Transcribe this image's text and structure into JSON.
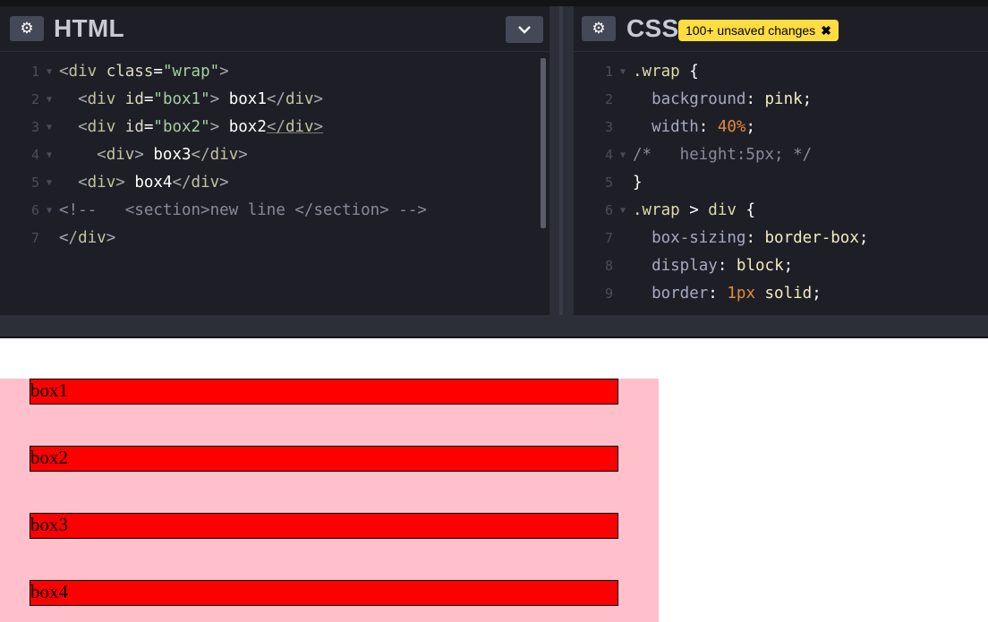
{
  "html_panel": {
    "title": "HTML",
    "lines": [
      {
        "n": "1",
        "fold": "▼",
        "tokens": [
          [
            "t-tag",
            "<"
          ],
          [
            "t-tagn",
            "div"
          ],
          [
            "t-txt",
            " "
          ],
          [
            "t-attr",
            "class"
          ],
          [
            "t-eq",
            "="
          ],
          [
            "t-str",
            "\"wrap\""
          ],
          [
            "t-tag",
            ">"
          ]
        ]
      },
      {
        "n": "2",
        "fold": "▼",
        "tokens": [
          [
            "t-txt",
            "  "
          ],
          [
            "t-tag",
            "<"
          ],
          [
            "t-tagn",
            "div"
          ],
          [
            "t-txt",
            " "
          ],
          [
            "t-attr",
            "id"
          ],
          [
            "t-eq",
            "="
          ],
          [
            "t-str",
            "\"box1\""
          ],
          [
            "t-tag",
            ">"
          ],
          [
            "t-text",
            " box1"
          ],
          [
            "t-tag",
            "</"
          ],
          [
            "t-tagn",
            "div"
          ],
          [
            "t-tag",
            ">"
          ]
        ]
      },
      {
        "n": "3",
        "fold": "▼",
        "tokens": [
          [
            "t-txt",
            "  "
          ],
          [
            "t-tag",
            "<"
          ],
          [
            "t-tagn",
            "div"
          ],
          [
            "t-txt",
            " "
          ],
          [
            "t-attr",
            "id"
          ],
          [
            "t-eq",
            "="
          ],
          [
            "t-str",
            "\"box2\""
          ],
          [
            "t-tag",
            ">"
          ],
          [
            "t-text",
            " box2"
          ],
          [
            "t-tag under",
            "</"
          ],
          [
            "t-tagn under",
            "div"
          ],
          [
            "t-tag under",
            ">"
          ]
        ]
      },
      {
        "n": "4",
        "fold": "▼",
        "tokens": [
          [
            "t-txt",
            "    "
          ],
          [
            "t-tag",
            "<"
          ],
          [
            "t-tagn",
            "div"
          ],
          [
            "t-tag",
            ">"
          ],
          [
            "t-text",
            " box3"
          ],
          [
            "t-tag",
            "</"
          ],
          [
            "t-tagn",
            "div"
          ],
          [
            "t-tag",
            ">"
          ]
        ]
      },
      {
        "n": "5",
        "fold": "▼",
        "tokens": [
          [
            "t-txt",
            "  "
          ],
          [
            "t-tag",
            "<"
          ],
          [
            "t-tagn",
            "div"
          ],
          [
            "t-tag",
            ">"
          ],
          [
            "t-text",
            " box4"
          ],
          [
            "t-tag",
            "</"
          ],
          [
            "t-tagn",
            "div"
          ],
          [
            "t-tag",
            ">"
          ]
        ]
      },
      {
        "n": "6",
        "fold": "▼",
        "tokens": [
          [
            "t-com",
            "<!--   <section>new line </section> -->"
          ]
        ]
      },
      {
        "n": "7",
        "fold": "",
        "tokens": [
          [
            "t-tag",
            "</"
          ],
          [
            "t-tagn",
            "div"
          ],
          [
            "t-tag",
            ">"
          ]
        ]
      }
    ]
  },
  "css_panel": {
    "title": "CSS",
    "badge": {
      "label": "100+ unsaved changes",
      "close": "✖"
    },
    "lines": [
      {
        "n": "1",
        "fold": "▼",
        "tokens": [
          [
            "t-sel",
            ".wrap"
          ],
          [
            "t-punc",
            " {"
          ]
        ]
      },
      {
        "n": "2",
        "fold": "",
        "tokens": [
          [
            "t-txt",
            "  "
          ],
          [
            "t-prop",
            "background"
          ],
          [
            "t-punc",
            ": "
          ],
          [
            "t-val",
            "pink"
          ],
          [
            "t-punc",
            ";"
          ]
        ]
      },
      {
        "n": "3",
        "fold": "",
        "tokens": [
          [
            "t-txt",
            "  "
          ],
          [
            "t-prop",
            "width"
          ],
          [
            "t-punc",
            ": "
          ],
          [
            "t-num",
            "40%"
          ],
          [
            "t-punc",
            ";"
          ]
        ]
      },
      {
        "n": "4",
        "fold": "▼",
        "tokens": [
          [
            "t-com",
            "/*   height:5px; */"
          ]
        ]
      },
      {
        "n": "5",
        "fold": "",
        "tokens": [
          [
            "t-punc",
            "}"
          ]
        ]
      },
      {
        "n": "6",
        "fold": "▼",
        "tokens": [
          [
            "t-sel",
            ".wrap"
          ],
          [
            "t-punc",
            " > "
          ],
          [
            "t-sel",
            "div"
          ],
          [
            "t-punc",
            " {"
          ]
        ]
      },
      {
        "n": "7",
        "fold": "",
        "tokens": [
          [
            "t-txt",
            "  "
          ],
          [
            "t-prop",
            "box-sizing"
          ],
          [
            "t-punc",
            ": "
          ],
          [
            "t-val",
            "border-box"
          ],
          [
            "t-punc",
            ";"
          ]
        ]
      },
      {
        "n": "8",
        "fold": "",
        "tokens": [
          [
            "t-txt",
            "  "
          ],
          [
            "t-prop",
            "display"
          ],
          [
            "t-punc",
            ": "
          ],
          [
            "t-val",
            "block"
          ],
          [
            "t-punc",
            ";"
          ]
        ]
      },
      {
        "n": "9",
        "fold": "",
        "tokens": [
          [
            "t-txt",
            "  "
          ],
          [
            "t-prop",
            "border"
          ],
          [
            "t-punc",
            ": "
          ],
          [
            "t-num",
            "1px"
          ],
          [
            "t-val",
            " solid"
          ],
          [
            "t-punc",
            ";"
          ]
        ]
      }
    ]
  },
  "preview": {
    "boxes": [
      "box1",
      "box2",
      "box3",
      "box4"
    ]
  }
}
